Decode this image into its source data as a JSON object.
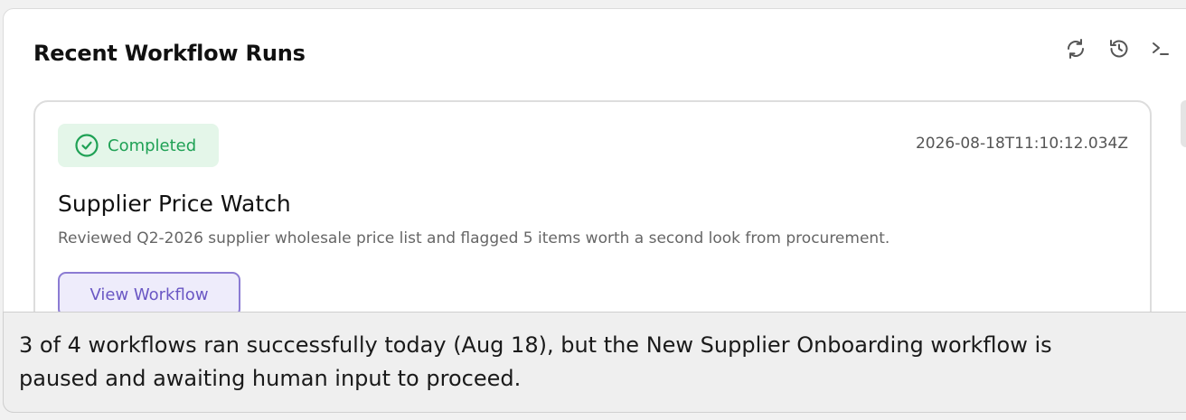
{
  "panel": {
    "title": "Recent Workflow Runs",
    "toolbar": [
      {
        "name": "refresh-icon"
      },
      {
        "name": "history-icon"
      },
      {
        "name": "terminal-icon"
      }
    ]
  },
  "run": {
    "status": "Completed",
    "status_icon": "check-circle-icon",
    "timestamp": "2026-08-18T11:10:12.034Z",
    "title": "Supplier Price Watch",
    "description": "Reviewed Q2-2026 supplier wholesale price list and flagged 5 items worth a second look from procurement.",
    "button_label": "View Workflow"
  },
  "summary": {
    "text": "3 of 4 workflows ran successfully today (Aug 18), but the New Supplier Onboarding workflow is paused and awaiting human input to proceed."
  },
  "colors": {
    "success": "#1fa155",
    "success_bg": "#e4f6e9",
    "accent": "#6a57c4",
    "accent_bg": "#eeecfb"
  }
}
